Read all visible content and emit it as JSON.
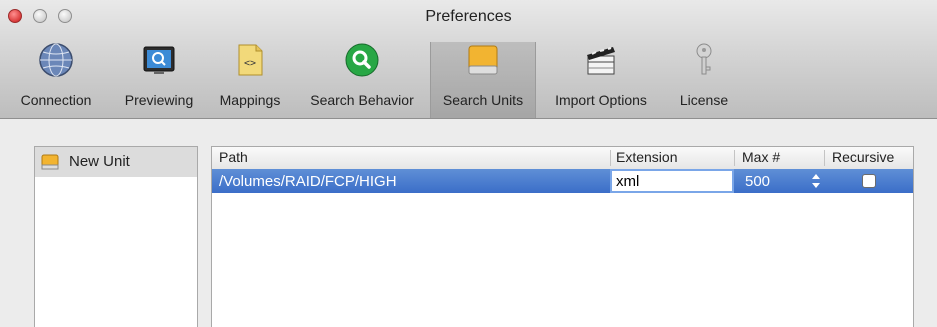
{
  "window": {
    "title": "Preferences"
  },
  "toolbar": {
    "items": [
      {
        "label": "Connection",
        "icon": "globe-icon",
        "selected": false
      },
      {
        "label": "Previewing",
        "icon": "monitor-icon",
        "selected": false
      },
      {
        "label": "Mappings",
        "icon": "xml-document-icon",
        "selected": false
      },
      {
        "label": "Search Behavior",
        "icon": "magnifier-icon",
        "selected": false
      },
      {
        "label": "Search Units",
        "icon": "hard-drive-icon",
        "selected": true
      },
      {
        "label": "Import Options",
        "icon": "clapperboard-icon",
        "selected": false
      },
      {
        "label": "License",
        "icon": "key-icon",
        "selected": false
      }
    ]
  },
  "units": {
    "items": [
      {
        "label": "New Unit",
        "icon": "drive-icon",
        "selected": true
      }
    ]
  },
  "table": {
    "headers": {
      "path": "Path",
      "extension": "Extension",
      "max": "Max #",
      "recursive": "Recursive"
    },
    "rows": [
      {
        "path": "/Volumes/RAID/FCP/HIGH",
        "extension": "xml",
        "max": "500",
        "recursive": false
      }
    ]
  },
  "colors": {
    "selection": "#3b6ec8",
    "close_button": "#d93a3a"
  }
}
